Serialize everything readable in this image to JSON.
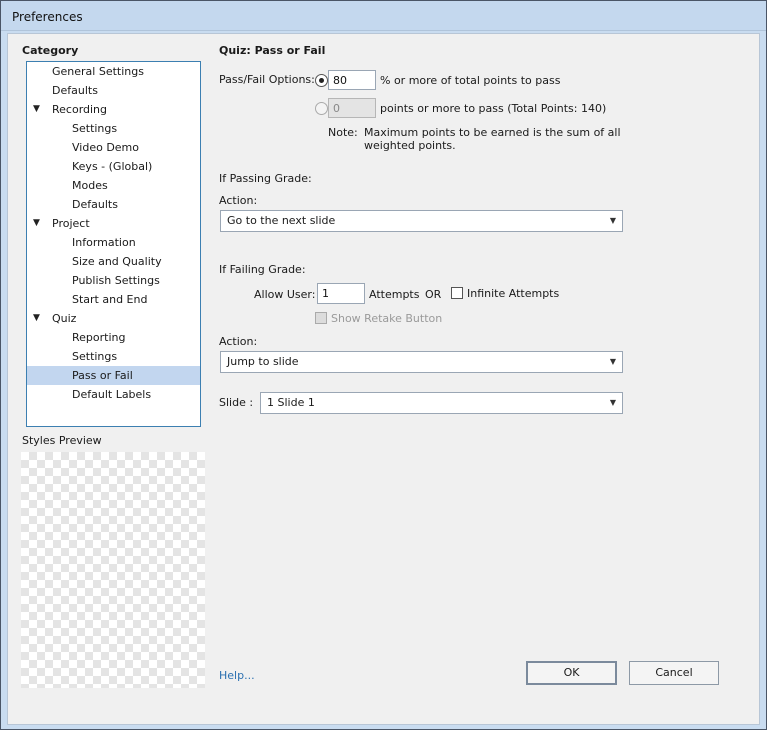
{
  "window": {
    "title": "Preferences"
  },
  "sidebar": {
    "category_label": "Category",
    "items": [
      {
        "label": "General Settings"
      },
      {
        "label": "Defaults"
      },
      {
        "label": "Recording",
        "arrow": "▼"
      },
      {
        "label": "Settings"
      },
      {
        "label": "Video Demo"
      },
      {
        "label": "Keys - (Global)"
      },
      {
        "label": "Modes"
      },
      {
        "label": "Defaults"
      },
      {
        "label": "Project",
        "arrow": "▼"
      },
      {
        "label": "Information"
      },
      {
        "label": "Size and Quality"
      },
      {
        "label": "Publish Settings"
      },
      {
        "label": "Start and End"
      },
      {
        "label": "Quiz",
        "arrow": "▼"
      },
      {
        "label": "Reporting"
      },
      {
        "label": "Settings"
      },
      {
        "label": "Pass or Fail"
      },
      {
        "label": "Default Labels"
      }
    ],
    "styles_preview_label": "Styles Preview"
  },
  "main": {
    "heading": "Quiz: Pass or Fail",
    "pass_fail": {
      "label": "Pass/Fail Options:",
      "percent_value": "80",
      "percent_text": "% or more of total points to pass",
      "points_value": "0",
      "points_text": "points or more to pass (Total Points: 140)",
      "note_label": "Note:",
      "note_line1": "Maximum points to be earned is the sum of all",
      "note_line2": "weighted points."
    },
    "passing": {
      "heading": "If Passing Grade:",
      "action_label": "Action:",
      "action_value": "Go to the next slide"
    },
    "failing": {
      "heading": "If Failing Grade:",
      "allow_label": "Allow User:",
      "attempts_value": "1",
      "attempts_text": "Attempts",
      "or_text": "OR",
      "infinite_label": "Infinite Attempts",
      "retake_label": "Show Retake Button",
      "action_label": "Action:",
      "action_value": "Jump to slide",
      "slide_label": "Slide :",
      "slide_value": "1 Slide 1"
    },
    "help_link": "Help...",
    "ok_label": "OK",
    "cancel_label": "Cancel"
  }
}
